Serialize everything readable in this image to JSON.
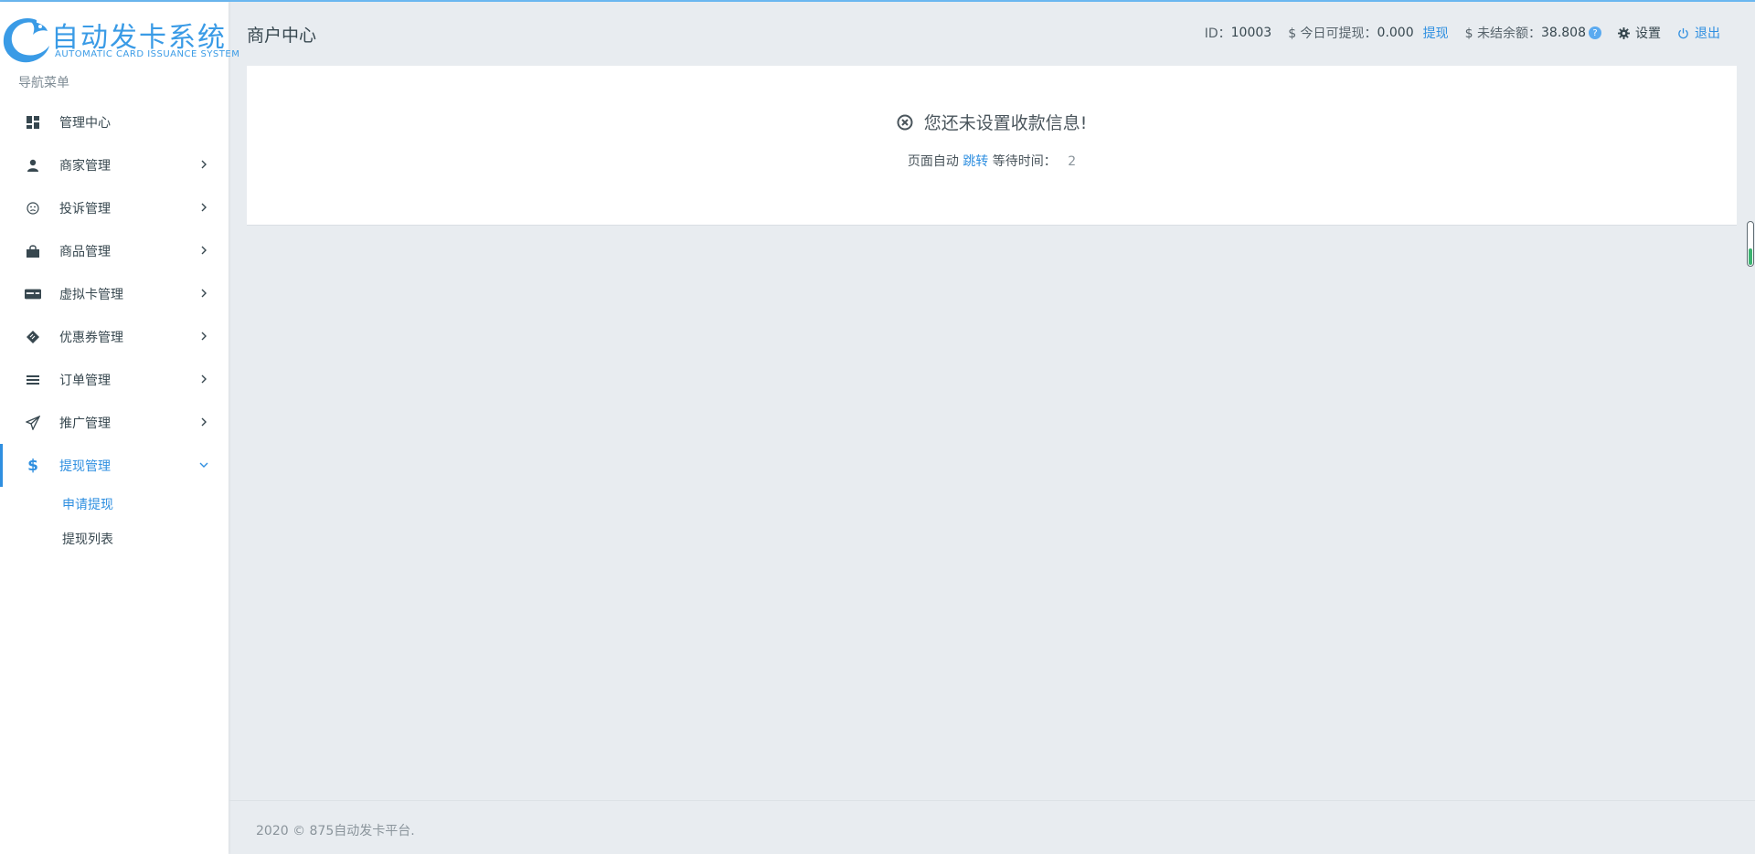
{
  "brand": {
    "title": "自动发卡系统",
    "subtitle": "AUTOMATIC CARD ISSUANCE SYSTEM",
    "color": "#3a9be6"
  },
  "sidebar": {
    "nav_title": "导航菜单",
    "items": [
      {
        "label": "管理中心",
        "icon": "dashboard-icon",
        "has_children": false
      },
      {
        "label": "商家管理",
        "icon": "user-icon",
        "has_children": true
      },
      {
        "label": "投诉管理",
        "icon": "sad-face-icon",
        "has_children": true
      },
      {
        "label": "商品管理",
        "icon": "shopping-bag-icon",
        "has_children": true
      },
      {
        "label": "虚拟卡管理",
        "icon": "credit-card-icon",
        "has_children": true
      },
      {
        "label": "优惠券管理",
        "icon": "ticket-icon",
        "has_children": true
      },
      {
        "label": "订单管理",
        "icon": "list-icon",
        "has_children": true
      },
      {
        "label": "推广管理",
        "icon": "paper-plane-icon",
        "has_children": true
      },
      {
        "label": "提现管理",
        "icon": "dollar-icon",
        "has_children": true,
        "expanded": true,
        "active": true
      }
    ],
    "sub_items": [
      {
        "label": "申请提现",
        "active": true
      },
      {
        "label": "提现列表",
        "active": false
      }
    ]
  },
  "header": {
    "title": "商户中心",
    "id_label": "ID：",
    "id_value": "10003",
    "today_label": "$ 今日可提现：",
    "today_value": "0.000",
    "withdraw_link": "提现",
    "unsettled_label": "$ 未结余额：",
    "unsettled_value": "38.808",
    "help_mark": "?",
    "settings_label": "设置",
    "logout_label": "退出"
  },
  "main": {
    "message": "您还未设置收款信息!",
    "redirect_prefix": "页面自动",
    "redirect_link": "跳转",
    "redirect_wait_label": "等待时间：",
    "redirect_count": "2"
  },
  "footer": {
    "text": "2020 © 875自动发卡平台."
  },
  "colors": {
    "accent": "#2f8fe0",
    "background": "#e8ecf0",
    "sidebar": "#ffffff",
    "scroll_fill": "#3cb371"
  }
}
